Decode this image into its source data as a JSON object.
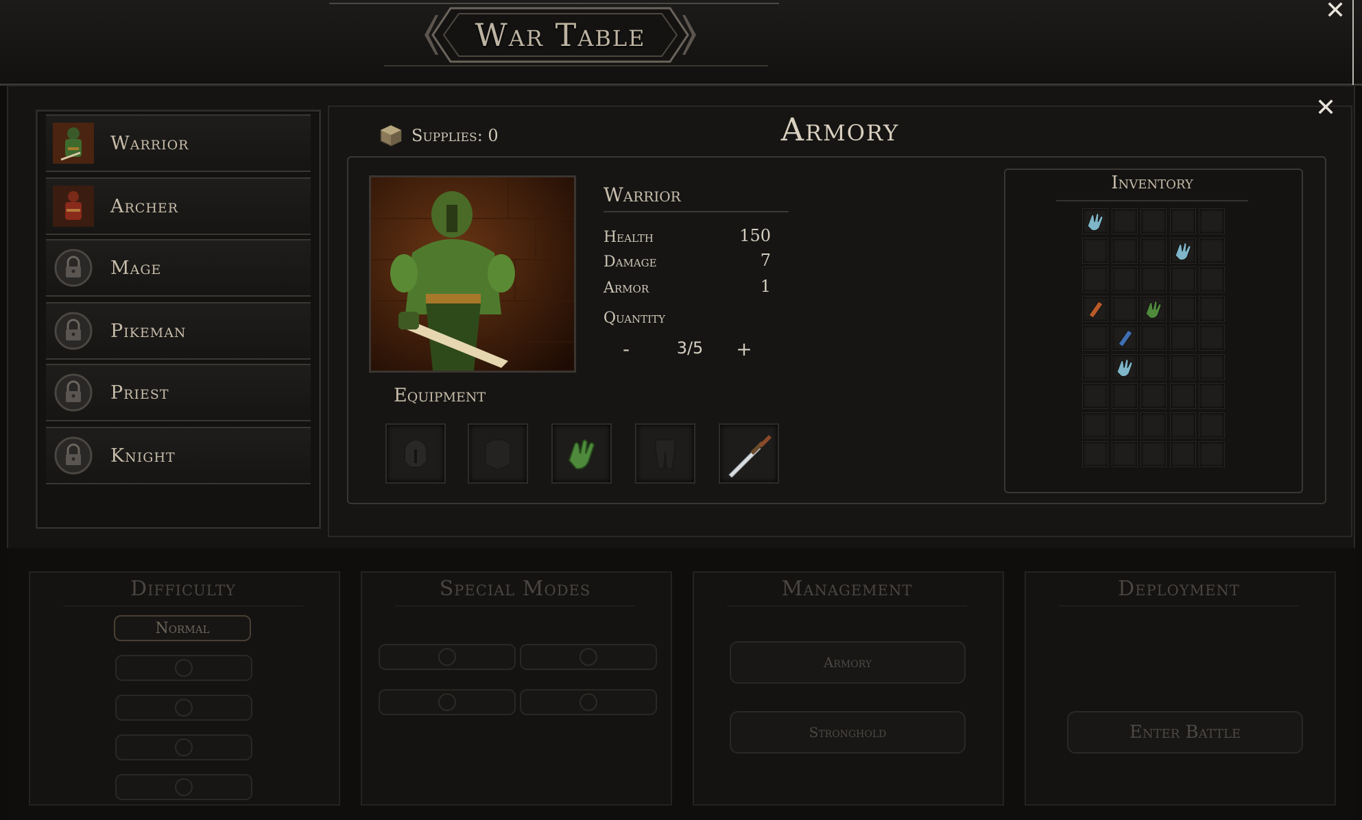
{
  "window": {
    "title": "War Table"
  },
  "units": [
    {
      "name": "Warrior",
      "locked": false
    },
    {
      "name": "Archer",
      "locked": false
    },
    {
      "name": "Mage",
      "locked": true
    },
    {
      "name": "Pikeman",
      "locked": true
    },
    {
      "name": "Priest",
      "locked": true
    },
    {
      "name": "Knight",
      "locked": true
    }
  ],
  "armory": {
    "title": "Armory",
    "supplies_label": "Supplies: 0",
    "unit_name": "Warrior",
    "stats": [
      {
        "label": "Health",
        "value": "150"
      },
      {
        "label": "Damage",
        "value": "7"
      },
      {
        "label": "Armor",
        "value": "1"
      }
    ],
    "quantity_label": "Quantity",
    "quantity_value": "3/5",
    "minus": "-",
    "plus": "+",
    "equipment_label": "Equipment",
    "equipment_slots": [
      "helmet-slot-empty",
      "chest-slot-empty",
      "gloves-equipped",
      "legs-slot-empty",
      "sword-equipped"
    ]
  },
  "inventory": {
    "title": "Inventory",
    "rows": 9,
    "cols": 5,
    "items": [
      {
        "row": 0,
        "col": 0,
        "icon": "blue-gauntlet-icon",
        "color": "#7fb6c9"
      },
      {
        "row": 1,
        "col": 3,
        "icon": "blue-gauntlet-icon",
        "color": "#7fb6c9"
      },
      {
        "row": 3,
        "col": 0,
        "icon": "orange-bracer-icon",
        "color": "#b85a2a"
      },
      {
        "row": 3,
        "col": 2,
        "icon": "green-glove-icon",
        "color": "#4f8a3c"
      },
      {
        "row": 4,
        "col": 1,
        "icon": "blue-bracer-icon",
        "color": "#3f6fb0"
      },
      {
        "row": 5,
        "col": 1,
        "icon": "blue-gauntlet-icon",
        "color": "#7fb6c9"
      }
    ]
  },
  "bottom": {
    "difficulty": {
      "title": "Difficulty",
      "selected": "Normal"
    },
    "special_modes": {
      "title": "Special Modes"
    },
    "management": {
      "title": "Management",
      "armory_btn": "Armory",
      "stronghold_btn": "Stronghold"
    },
    "deployment": {
      "title": "Deployment",
      "enter_btn": "Enter Battle"
    }
  },
  "colors": {
    "accent": "#c9c0b1",
    "background": "#0e0d0c",
    "muted": "#4a4541"
  }
}
